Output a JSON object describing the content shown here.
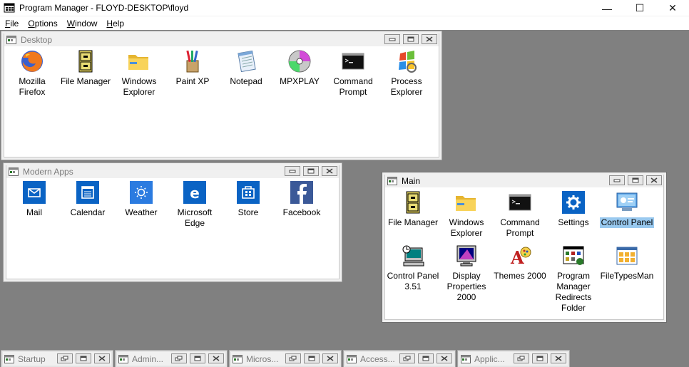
{
  "window": {
    "title": "Program Manager - FLOYD-DESKTOP\\floyd",
    "caption_minimize": "—",
    "caption_maximize": "☐",
    "caption_close": "✕"
  },
  "menu": {
    "file": {
      "key": "F",
      "rest": "ile"
    },
    "options": {
      "key": "O",
      "rest": "ptions"
    },
    "window": {
      "key": "W",
      "rest": "indow"
    },
    "help": {
      "key": "H",
      "rest": "elp"
    }
  },
  "groups": {
    "desktop": {
      "title": "Desktop",
      "items": [
        {
          "label": "Mozilla Firefox",
          "icon": "firefox-icon"
        },
        {
          "label": "File Manager",
          "icon": "file-cabinet-icon"
        },
        {
          "label": "Windows Explorer",
          "icon": "folder-icon"
        },
        {
          "label": "Paint XP",
          "icon": "paint-brushes-icon"
        },
        {
          "label": "Notepad",
          "icon": "notepad-icon"
        },
        {
          "label": "MPXPLAY",
          "icon": "cd-icon"
        },
        {
          "label": "Command Prompt",
          "icon": "console-icon"
        },
        {
          "label": "Process Explorer",
          "icon": "windows-flag-icon"
        }
      ]
    },
    "modern": {
      "title": "Modern Apps",
      "items": [
        {
          "label": "Mail",
          "icon": "mail-icon"
        },
        {
          "label": "Calendar",
          "icon": "calendar-icon"
        },
        {
          "label": "Weather",
          "icon": "weather-icon"
        },
        {
          "label": "Microsoft Edge",
          "icon": "edge-icon"
        },
        {
          "label": "Store",
          "icon": "store-icon"
        },
        {
          "label": "Facebook",
          "icon": "facebook-icon"
        }
      ]
    },
    "main": {
      "title": "Main",
      "selected": "Control Panel",
      "items": [
        {
          "label": "File Manager",
          "icon": "file-cabinet-icon"
        },
        {
          "label": "Windows Explorer",
          "icon": "folder-icon"
        },
        {
          "label": "Command Prompt",
          "icon": "console-icon"
        },
        {
          "label": "Settings",
          "icon": "gear-icon"
        },
        {
          "label": "Control Panel",
          "icon": "control-panel-icon"
        },
        {
          "label": "Control Panel 3.51",
          "icon": "control-panel-351-icon"
        },
        {
          "label": "Display Properties 2000",
          "icon": "display-properties-icon"
        },
        {
          "label": "Themes 2000",
          "icon": "themes-icon"
        },
        {
          "label": "Program Manager Redirects Folder",
          "icon": "progman-redirect-icon"
        },
        {
          "label": "FileTypesMan",
          "icon": "filetypesman-icon"
        }
      ]
    }
  },
  "minimized": [
    {
      "label": "Startup"
    },
    {
      "label": "Admin..."
    },
    {
      "label": "Micros..."
    },
    {
      "label": "Access..."
    },
    {
      "label": "Applic..."
    }
  ],
  "colors": {
    "desktop_bg": "#808080",
    "selection": "#99c9ef",
    "modern_tile": "#0a63c4"
  }
}
